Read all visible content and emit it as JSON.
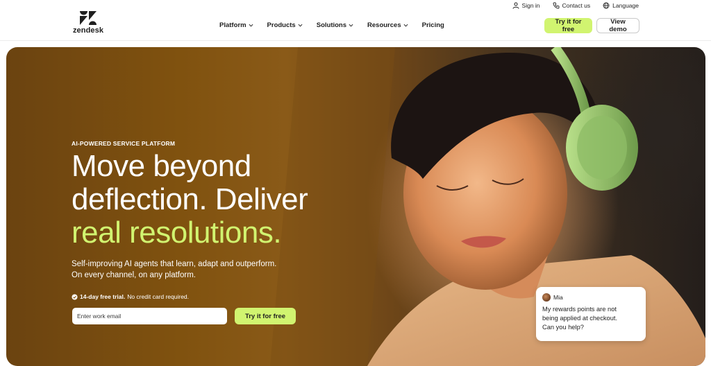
{
  "utility": {
    "sign_in": "Sign in",
    "contact_us": "Contact us",
    "language": "Language",
    "icons": [
      "user-icon",
      "phone-icon",
      "globe-icon"
    ]
  },
  "brand": {
    "wordmark": "zendesk",
    "logo_icon": "zendesk-z-logo-icon"
  },
  "nav": {
    "items": [
      {
        "label": "Platform",
        "has_dropdown": true
      },
      {
        "label": "Products",
        "has_dropdown": true
      },
      {
        "label": "Solutions",
        "has_dropdown": true
      },
      {
        "label": "Resources",
        "has_dropdown": true
      },
      {
        "label": "Pricing",
        "has_dropdown": false
      }
    ],
    "try_free": "Try it for free",
    "view_demo": "View demo"
  },
  "hero": {
    "eyebrow": "AI-POWERED SERVICE PLATFORM",
    "headline_line1": "Move beyond",
    "headline_line2": "deflection. Deliver",
    "headline_accent": "real resolutions.",
    "sub_line1": "Self-improving AI agents that learn, adapt and outperform.",
    "sub_line2": "On every channel, on any platform.",
    "trial_bold": "14-day free trial.",
    "trial_rest": "No credit card required.",
    "email_placeholder": "Enter work email",
    "cta": "Try it for free"
  },
  "chat_bubble": {
    "name": "Mia",
    "line1": "My rewards points are not",
    "line2": "being applied at checkout.",
    "line3": "Can you help?"
  },
  "colors": {
    "accent": "#d1f470",
    "text_dark": "#1f1f1f",
    "hero_brown": "#80520f",
    "white": "#ffffff"
  }
}
